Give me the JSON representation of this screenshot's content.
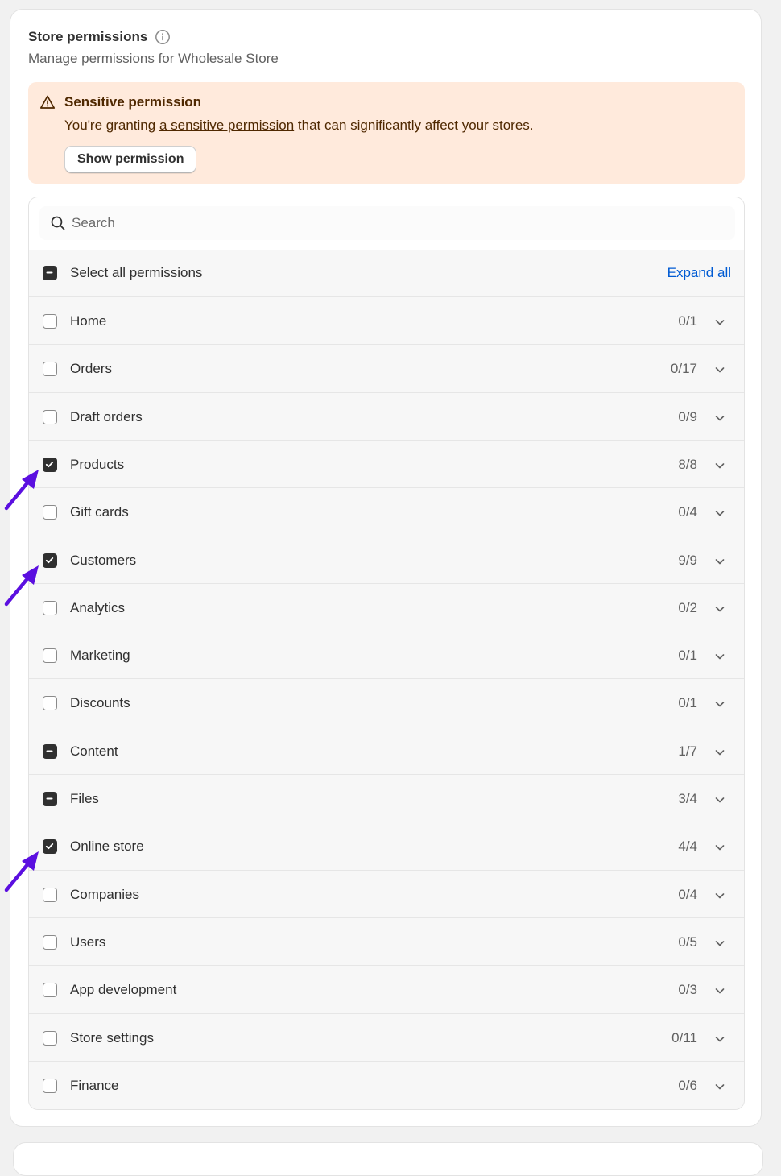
{
  "header": {
    "title": "Store permissions",
    "subtitle": "Manage permissions for Wholesale Store"
  },
  "banner": {
    "title": "Sensitive permission",
    "text_before": "You're granting ",
    "link_text": "a sensitive permission",
    "text_after": " that can significantly affect your stores.",
    "button_label": "Show permission"
  },
  "search": {
    "placeholder": "Search"
  },
  "select_all": {
    "label": "Select all permissions",
    "state": "indeterminate",
    "expand_label": "Expand all"
  },
  "permissions": [
    {
      "label": "Home",
      "count": "0/1",
      "state": "unchecked"
    },
    {
      "label": "Orders",
      "count": "0/17",
      "state": "unchecked"
    },
    {
      "label": "Draft orders",
      "count": "0/9",
      "state": "unchecked"
    },
    {
      "label": "Products",
      "count": "8/8",
      "state": "checked"
    },
    {
      "label": "Gift cards",
      "count": "0/4",
      "state": "unchecked"
    },
    {
      "label": "Customers",
      "count": "9/9",
      "state": "checked"
    },
    {
      "label": "Analytics",
      "count": "0/2",
      "state": "unchecked"
    },
    {
      "label": "Marketing",
      "count": "0/1",
      "state": "unchecked"
    },
    {
      "label": "Discounts",
      "count": "0/1",
      "state": "unchecked"
    },
    {
      "label": "Content",
      "count": "1/7",
      "state": "indeterminate"
    },
    {
      "label": "Files",
      "count": "3/4",
      "state": "indeterminate"
    },
    {
      "label": "Online store",
      "count": "4/4",
      "state": "checked"
    },
    {
      "label": "Companies",
      "count": "0/4",
      "state": "unchecked"
    },
    {
      "label": "Users",
      "count": "0/5",
      "state": "unchecked"
    },
    {
      "label": "App development",
      "count": "0/3",
      "state": "unchecked"
    },
    {
      "label": "Store settings",
      "count": "0/11",
      "state": "unchecked"
    },
    {
      "label": "Finance",
      "count": "0/6",
      "state": "unchecked"
    }
  ],
  "annotations": {
    "arrow_color": "#5b0fe0",
    "arrow_targets": [
      "Products",
      "Customers",
      "Online store"
    ]
  },
  "colors": {
    "banner_bg": "#ffeadc",
    "banner_text": "#4f2800",
    "link_blue": "#005bd3",
    "checkbox_dark": "#303030"
  }
}
